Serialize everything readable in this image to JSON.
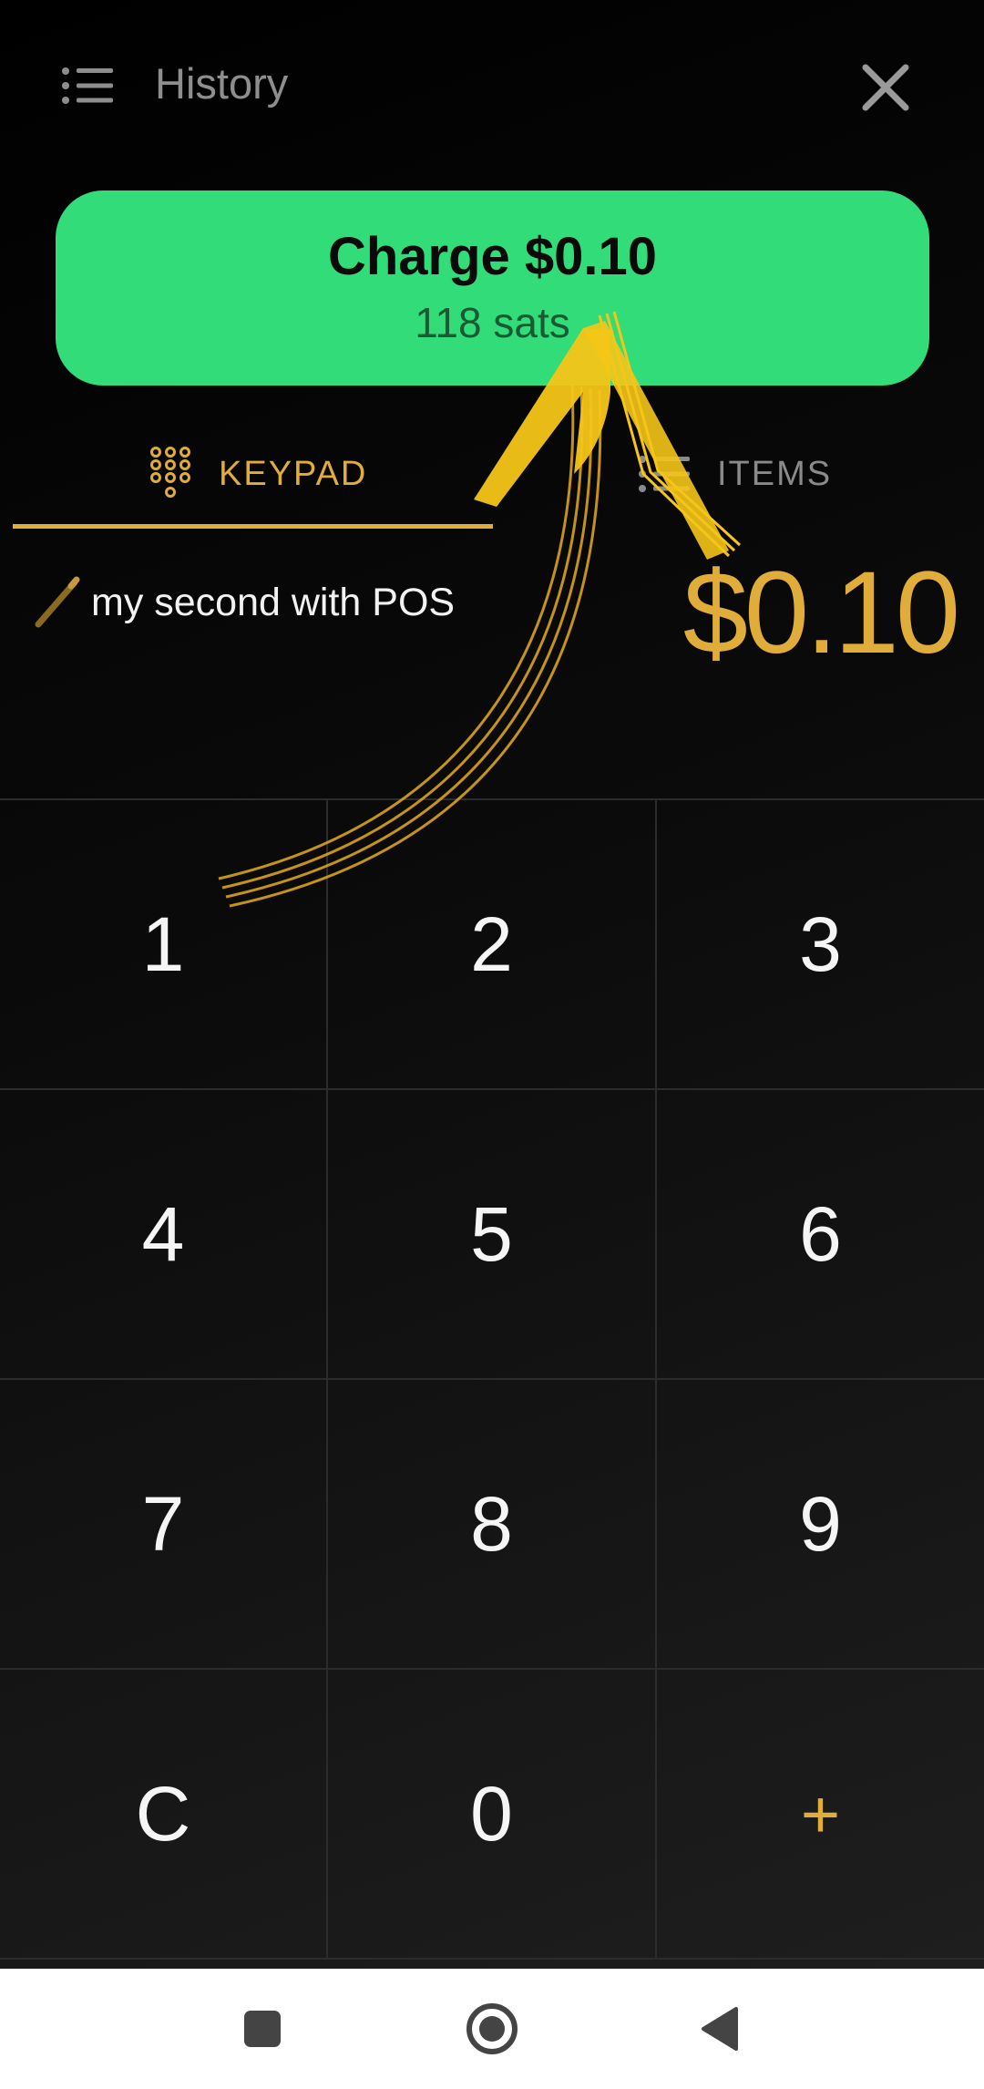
{
  "header": {
    "menu_icon": "list-menu-icon",
    "history_label": "History",
    "close_icon": "close-icon"
  },
  "charge": {
    "label": "Charge $0.10",
    "sats": "118 sats",
    "color": "#32dc78"
  },
  "tabs": [
    {
      "label": "KEYPAD",
      "icon": "keypad-icon",
      "active": true
    },
    {
      "label": "ITEMS",
      "icon": "list-icon",
      "active": false
    }
  ],
  "memo": {
    "icon": "pencil-icon",
    "text": "my second with POS"
  },
  "amount": "$0.10",
  "keypad": {
    "keys": [
      "1",
      "2",
      "3",
      "4",
      "5",
      "6",
      "7",
      "8",
      "9",
      "C",
      "0",
      "+"
    ]
  },
  "colors": {
    "accent": "#e0ac3a",
    "charge_green": "#32dc78",
    "annotation_arrow": "#f5c518"
  },
  "navbar": {
    "recents_icon": "square-recents-icon",
    "home_icon": "circle-home-icon",
    "back_icon": "triangle-back-icon"
  }
}
